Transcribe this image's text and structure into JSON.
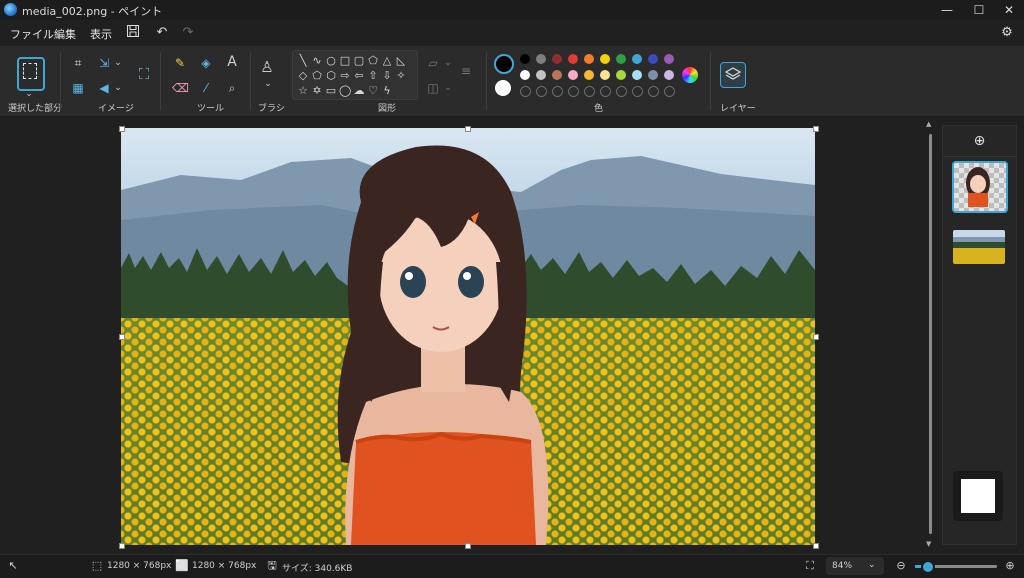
{
  "window": {
    "title": "media_002.png - ペイント"
  },
  "menu": {
    "file": "ファイル",
    "edit": "編集",
    "view": "表示"
  },
  "ribbon": {
    "groups": {
      "selection": "選択した部分",
      "image": "イメージ",
      "tools": "ツール",
      "brushes": "ブラシ",
      "shapes": "図形",
      "colors": "色",
      "layers": "レイヤー"
    },
    "palette_row1": [
      "#000000",
      "#7f7f7f",
      "#8b2e2e",
      "#e03c31",
      "#f47a2d",
      "#f3d20c",
      "#2f9e44",
      "#3fa7d6",
      "#3b4cc0",
      "#9b59b6"
    ],
    "palette_row2": [
      "#ffffff",
      "#c3c3c3",
      "#b5765b",
      "#f5a9c8",
      "#f7b733",
      "#f6e58d",
      "#a8d83a",
      "#a6dff2",
      "#7f8fa6",
      "#c9b6e4"
    ],
    "primary_color": "#000000",
    "secondary_color": "#ffffff"
  },
  "status": {
    "selection_size": "1280 × 768px",
    "canvas_size": "1280 × 768px",
    "file_size": "サイズ: 340.6KB",
    "zoom": "84%"
  }
}
